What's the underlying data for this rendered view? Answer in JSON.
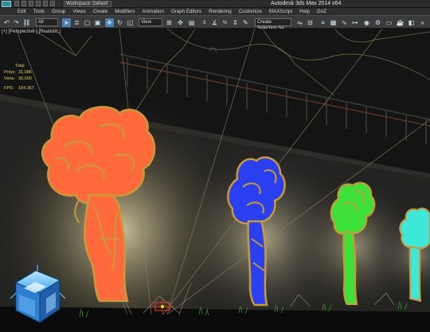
{
  "titlebar": {
    "workspace": "Workspace: Default",
    "app_title": "Autodesk 3ds Max  2014 x64"
  },
  "menubar": {
    "items": [
      "Edit",
      "Tools",
      "Group",
      "Views",
      "Create",
      "Modifiers",
      "Animation",
      "Graph Editors",
      "Rendering",
      "Customize",
      "MAXScript",
      "Help",
      "GoZ"
    ]
  },
  "toolbar": {
    "selection_filter": "All",
    "view_dropdown": "View",
    "named_selection": "Create Selection Se",
    "snap_value": "3",
    "percent_snap": "%"
  },
  "viewport": {
    "label": "[+] [Perspective ] [Realistic ]",
    "stats": {
      "header": "Total",
      "rows": [
        {
          "key": "Polys:",
          "value": "31,086"
        },
        {
          "key": "Verts:",
          "value": "30,000"
        }
      ],
      "fps_key": "FPS:",
      "fps_value": "104.367"
    }
  },
  "colors": {
    "tree_orange": "#ff6a3c",
    "tree_blue": "#2a3ff0",
    "tree_green": "#3ee03a",
    "tree_cyan": "#3ee8d8",
    "frame_gold": "#c89a3a",
    "stats_yellow": "#e6cd58",
    "toolbar_active": "#4d7fb3"
  },
  "icons": [
    "select-object-icon",
    "select-by-name-icon",
    "select-region-icon",
    "window-crossing-icon",
    "move-icon",
    "rotate-icon",
    "scale-icon",
    "mirror-icon",
    "align-icon",
    "layer-manager-icon",
    "curve-editor-icon",
    "schematic-view-icon",
    "material-editor-icon",
    "render-setup-icon",
    "render-frame-icon",
    "render-icon",
    "snap-toggle-icon",
    "angle-snap-icon"
  ]
}
